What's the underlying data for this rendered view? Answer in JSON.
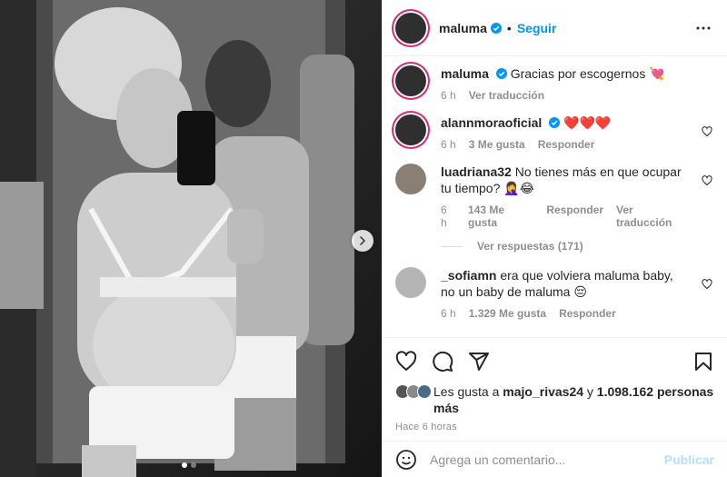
{
  "header": {
    "username": "maluma",
    "follow_label": "Seguir",
    "dot": "•"
  },
  "caption": {
    "username": "maluma",
    "text": "Gracias por escogernos 💘",
    "time": "6 h",
    "translate": "Ver traducción"
  },
  "comments": [
    {
      "username": "alannmoraoficial",
      "verified": true,
      "text": "❤️❤️❤️",
      "time": "6 h",
      "likes": "3 Me gusta",
      "reply": "Responder",
      "translate": ""
    },
    {
      "username": "luadriana32",
      "verified": false,
      "text": "No tienes más en que ocupar tu tiempo? 🤦‍♀️😂",
      "time": "6 h",
      "likes": "143 Me gusta",
      "reply": "Responder",
      "translate": "Ver traducción"
    },
    {
      "username": "_sofiamn",
      "verified": false,
      "text": "era que volviera maluma baby, no un baby de maluma 😔",
      "time": "6 h",
      "likes": "1.329 Me gusta",
      "reply": "Responder",
      "translate": ""
    }
  ],
  "view_replies": "Ver respuestas (171)",
  "likes": {
    "prefix": "Les gusta a",
    "user": "majo_rivas24",
    "connector": "y",
    "count": "1.098.162 personas más"
  },
  "time_ago": "HACE 6 HORAS",
  "time_ago_display": "Hace 6 horas",
  "comment_box": {
    "placeholder": "Agrega un comentario...",
    "publish": "Publicar"
  },
  "icons": {
    "verified": "verified-badge-icon",
    "heart": "heart-icon",
    "comment": "comment-icon",
    "share": "share-icon",
    "save": "bookmark-icon",
    "more": "more-options-icon",
    "emoji": "emoji-icon",
    "next": "chevron-right-icon"
  },
  "colors": {
    "accent": "#0095f6",
    "verified": "#0095f6",
    "publish_disabled": "#b2dffc",
    "secondary_text": "#8e8e8e"
  },
  "carousel": {
    "slides": 2,
    "active": 1
  }
}
